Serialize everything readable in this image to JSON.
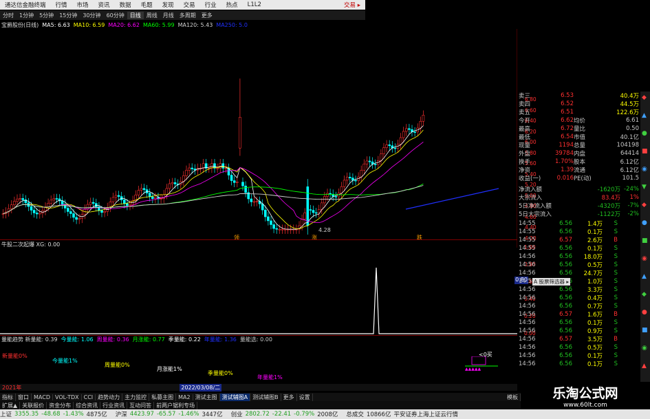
{
  "titlebar": {
    "app_title": "通达信金融终端",
    "menu": [
      "行情",
      "市场",
      "资讯",
      "数据",
      "毛题",
      "发现",
      "交易",
      "行业",
      "热点",
      "L1L2"
    ],
    "right": "交易 ▸"
  },
  "periodbar": {
    "items": [
      "分时",
      "1分钟",
      "5分钟",
      "15分钟",
      "30分钟",
      "60分钟",
      "日线",
      "周线",
      "月线",
      "多周期",
      "更多"
    ],
    "active": "日线"
  },
  "ma_bar": {
    "stock": "宝爵股份(日线)",
    "items": [
      {
        "label": "MA5: 6.63",
        "color": "#ffffff"
      },
      {
        "label": "MA10: 6.59",
        "color": "#ffff00"
      },
      {
        "label": "MA20: 6.62",
        "color": "#ff00ff"
      },
      {
        "label": "MA60: 5.99",
        "color": "#00ff00"
      },
      {
        "label": "MA120: 5.43",
        "color": "#d0d0d0"
      },
      {
        "label": "MA250: 5.0",
        "color": "#2030ff"
      }
    ]
  },
  "chart_data": {
    "type": "candlestick",
    "price_axis": [
      "6.80",
      "6.60",
      "6.40",
      "6.20",
      "6.00",
      "5.80",
      "5.60",
      "5.40",
      "5.20",
      "5.00",
      "4.80",
      "4.60",
      "4.40",
      "4.20"
    ],
    "low_label": "4.28",
    "markers": [
      "领",
      "涨",
      "跌"
    ],
    "indicator1": {
      "name": "牛股二次起爆 XG: 0.00",
      "axis": [
        "1.00",
        "0.80",
        "0.60",
        "0.40",
        "0.20",
        "0.00"
      ],
      "current": "0.80"
    },
    "indicator2": {
      "title": "量能趋势 新量能: 0.39",
      "items": [
        {
          "label": "今量能: 1.06",
          "color": "#00ffff"
        },
        {
          "label": "周量能: 0.36",
          "color": "#ff00ff"
        },
        {
          "label": "月涨能: 0.77",
          "color": "#00ff00"
        },
        {
          "label": "季量能: 0.22",
          "color": "#ffffff"
        },
        {
          "label": "年量能: 1.36",
          "color": "#2030ff"
        },
        {
          "label": "量能选: 0.00",
          "color": "#c8c8c8"
        }
      ],
      "labels": [
        {
          "t": "新量能0%",
          "c": "#ff3030"
        },
        {
          "t": "今量能1%",
          "c": "#00ffff"
        },
        {
          "t": "周量能0%",
          "c": "#ffff00"
        },
        {
          "t": "月涨能1%",
          "c": "#ffffff"
        },
        {
          "t": "季量能0%",
          "c": "#ffff00"
        },
        {
          "t": "年量能1%",
          "c": "#ff00ff"
        }
      ],
      "corner_label": "<0买"
    },
    "dates": [
      "2021年",
      "2022/03/08/二"
    ]
  },
  "rightpanel": {
    "asks": [
      {
        "l": "卖三",
        "p": "6.53",
        "v": "40.4万"
      },
      {
        "l": "卖四",
        "p": "6.52",
        "v": "44.5万"
      },
      {
        "l": "卖五",
        "p": "6.51",
        "v": "122.6万"
      }
    ],
    "stats": [
      {
        "a": "今开",
        "av": "6.62",
        "b": "均价",
        "bv": "6.61"
      },
      {
        "a": "最高",
        "av": "6.72",
        "b": "量比",
        "bv": "0.50"
      },
      {
        "a": "最低",
        "av": "6.54",
        "b": "市值",
        "bv": "40.1亿"
      },
      {
        "a": "现量",
        "av": "1194",
        "b": "总量",
        "bv": "104198"
      },
      {
        "a": "外盘",
        "av": "39784",
        "b": "内盘",
        "bv": "64414"
      },
      {
        "a": "换手",
        "av": "1.70%",
        "b": "股本",
        "bv": "6.12亿"
      },
      {
        "a": "净资",
        "av": "1.39",
        "b": "流通",
        "bv": "6.12亿"
      },
      {
        "a": "收益(一)",
        "av": "0.016",
        "b": "PE(动)",
        "bv": "101.5"
      }
    ],
    "flows": [
      {
        "l": "净流入额",
        "v": "-1620万",
        "p": "-24%"
      },
      {
        "l": "大宗流入",
        "v": "83.4万",
        "p": "1%"
      },
      {
        "l": "5日净流入额",
        "v": "-4320万",
        "p": "-7%"
      },
      {
        "l": "5日大宗流入",
        "v": "-1122万",
        "p": "-2%"
      }
    ],
    "ticks": [
      {
        "t": "14:55",
        "p": "6.56",
        "v": "1.4万",
        "s": "S"
      },
      {
        "t": "14:55",
        "p": "6.56",
        "v": "0.1万",
        "s": "S"
      },
      {
        "t": "14:55",
        "p": "6.57",
        "v": "2.6万",
        "s": "B"
      },
      {
        "t": "14:55",
        "p": "6.56",
        "v": "0.1万",
        "s": "S"
      },
      {
        "t": "14:56",
        "p": "6.56",
        "v": "18.0万",
        "s": "S"
      },
      {
        "t": "14:56",
        "p": "6.56",
        "v": "0.5万",
        "s": "S"
      },
      {
        "t": "14:56",
        "p": "6.56",
        "v": "24.7万",
        "s": "S"
      },
      {
        "t": "14:56",
        "p": "6.56",
        "v": "1.0万",
        "s": "S"
      },
      {
        "t": "14:56",
        "p": "6.56",
        "v": "3.3万",
        "s": "S"
      },
      {
        "t": "14:56",
        "p": "6.56",
        "v": "0.4万",
        "s": "S"
      },
      {
        "t": "14:56",
        "p": "6.56",
        "v": "0.7万",
        "s": "S"
      },
      {
        "t": "14:56",
        "p": "6.57",
        "v": "1.6万",
        "s": "B"
      },
      {
        "t": "14:56",
        "p": "6.56",
        "v": "0.1万",
        "s": "S"
      },
      {
        "t": "14:56",
        "p": "6.56",
        "v": "0.9万",
        "s": "S"
      },
      {
        "t": "14:56",
        "p": "6.57",
        "v": "3.5万",
        "s": "B"
      },
      {
        "t": "14:56",
        "p": "6.56",
        "v": "0.5万",
        "s": "S"
      },
      {
        "t": "14:56",
        "p": "6.56",
        "v": "0.1万",
        "s": "S"
      },
      {
        "t": "14:56",
        "p": "6.56",
        "v": "0.1万",
        "s": "S"
      }
    ],
    "tooltip": "A 股票筛选器 ▸"
  },
  "bottomtabs": {
    "row1": [
      "扩展▲",
      "关联报价",
      "资金分布",
      "综合资讯",
      "行业资讯",
      "互动问答",
      "前两户锯利专场"
    ],
    "row2": [
      "指标",
      "窗口",
      "MACD",
      "VOL-TDX",
      "CCI",
      "趋势动力",
      "主力监控",
      "私募主图",
      "MA2",
      "测试主图",
      "测试辅图A",
      "测试辅图B",
      "更多",
      "设置"
    ],
    "right": "模板"
  },
  "statusbar": [
    {
      "t": "上证",
      "c": ""
    },
    {
      "t": "3355.35",
      "c": "dn"
    },
    {
      "t": "-48.68",
      "c": "dn"
    },
    {
      "t": "-1.43%",
      "c": "dn"
    },
    {
      "t": "4875亿",
      "c": ""
    },
    {
      "t": "沪深",
      "c": ""
    },
    {
      "t": "4423.97",
      "c": "dn"
    },
    {
      "t": "-65.57",
      "c": "dn"
    },
    {
      "t": "-1.46%",
      "c": "dn"
    },
    {
      "t": "3447亿",
      "c": ""
    },
    {
      "t": "创业",
      "c": ""
    },
    {
      "t": "2802.72",
      "c": "dn"
    },
    {
      "t": "-22.41",
      "c": "dn"
    },
    {
      "t": "-0.79%",
      "c": "dn"
    },
    {
      "t": "2008亿",
      "c": ""
    },
    {
      "t": "总成交",
      "c": ""
    },
    {
      "t": "10866亿",
      "c": ""
    },
    {
      "t": "平安证券上海上证云行情",
      "c": ""
    }
  ],
  "watermark": {
    "title": "乐淘公式网",
    "url": "www.60lt.com"
  }
}
